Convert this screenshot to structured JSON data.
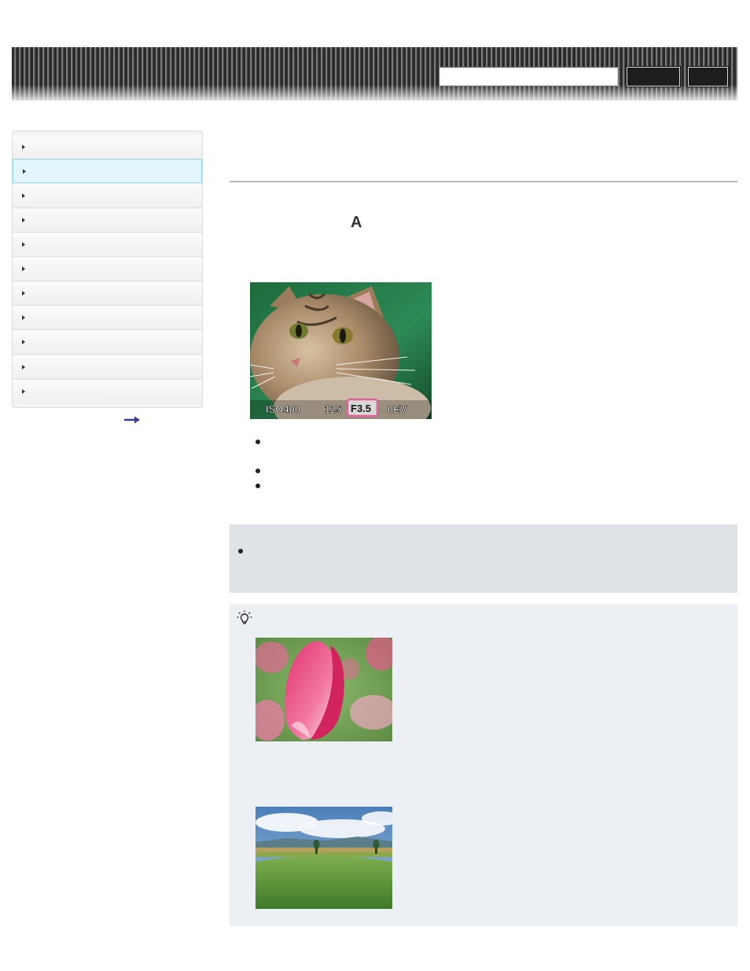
{
  "header": {
    "search_placeholder": "",
    "search_label": "",
    "top_label": ""
  },
  "sidebar": {
    "items": [
      {
        "label": ""
      },
      {
        "label": ""
      },
      {
        "label": ""
      },
      {
        "label": ""
      },
      {
        "label": ""
      },
      {
        "label": ""
      },
      {
        "label": ""
      },
      {
        "label": ""
      },
      {
        "label": ""
      },
      {
        "label": ""
      },
      {
        "label": ""
      }
    ],
    "active_index": 1,
    "more_link_icon": "right-arrow-icon"
  },
  "main": {
    "title": "",
    "mode_letter": "A",
    "cat_overlay": {
      "iso": "ISO400",
      "shutter": "125",
      "aperture": "F3.5",
      "ev": "0EV"
    },
    "bullets": [
      "",
      "",
      ""
    ],
    "note_bullet": "",
    "hint_icon": "lightbulb-icon"
  },
  "colors": {
    "active_item_bg": "#e3f6fc",
    "active_item_border": "#8fd8ee",
    "note_bg": "#dfe2e7",
    "hint_bg": "#eceff4",
    "aperture_highlight": "#e0609a"
  }
}
